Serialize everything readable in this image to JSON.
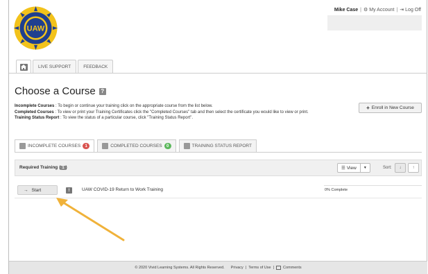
{
  "logo": {
    "text": "UAW"
  },
  "user": {
    "name": "Mike Case",
    "my_account": "My Account",
    "log_off": "Log Off"
  },
  "top_tabs": [
    "LIVE SUPPORT",
    "FEEDBACK"
  ],
  "page_title": "Choose a Course",
  "description": {
    "incomplete_label": "Incomplete Courses",
    "incomplete_text": " : To begin or continue your training click on the appropriate course from the list below.",
    "completed_label": "Completed Courses",
    "completed_text": " : To view or print your Training Certificates click the \"Completed Courses\" tab and then select the certificate you would like to view or print.",
    "status_label": "Training Status Report",
    "status_text": " : To view the status of a particular course, click \"Training Status Report\"."
  },
  "enroll_button": "Enroll in New Course",
  "course_tabs": {
    "incomplete": {
      "label": "INCOMPLETE COURSES",
      "count": "1",
      "color": "#d9534f"
    },
    "completed": {
      "label": "COMPLETED COURSES",
      "count": "0",
      "color": "#5cb85c"
    },
    "status": {
      "label": "TRAINING STATUS REPORT"
    }
  },
  "panel": {
    "title": "Required Training",
    "count": "1",
    "view_label": "View",
    "sort_label": "Sort:"
  },
  "course": {
    "start_label": "Start",
    "info_label": "!",
    "name": "UAW COVID-19 Return to Work Training",
    "progress_text": "0% Complete",
    "progress": 0
  },
  "footer": {
    "copyright": "© 2020 Vivid Learning Systems. All Rights Reserved.",
    "privacy": "Privacy",
    "terms": "Terms of Use",
    "comments": "Comments"
  },
  "colors": {
    "annotation_arrow": "#f0b23a",
    "logo_blue": "#1f3f8f",
    "logo_gold": "#f2c21b"
  }
}
